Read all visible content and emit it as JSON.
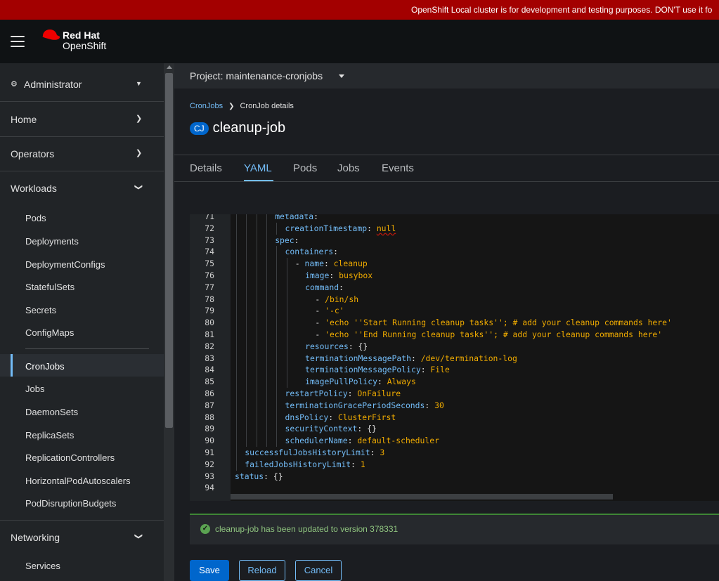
{
  "banner": {
    "text": "OpenShift Local cluster is for development and testing purposes. DON'T use it fo"
  },
  "masthead": {
    "brand_line1": "Red Hat",
    "brand_line2": "OpenShift"
  },
  "sidebar": {
    "perspective": "Administrator",
    "sections": {
      "home": "Home",
      "operators": "Operators",
      "workloads": "Workloads",
      "networking": "Networking"
    },
    "workload_items": [
      "Pods",
      "Deployments",
      "DeploymentConfigs",
      "StatefulSets",
      "Secrets",
      "ConfigMaps",
      "CronJobs",
      "Jobs",
      "DaemonSets",
      "ReplicaSets",
      "ReplicationControllers",
      "HorizontalPodAutoscalers",
      "PodDisruptionBudgets"
    ],
    "networking_items": [
      "Services"
    ],
    "active_item": "CronJobs"
  },
  "project": {
    "label": "Project: maintenance-cronjobs"
  },
  "breadcrumb": {
    "parent": "CronJobs",
    "current": "CronJob details"
  },
  "resource": {
    "badge": "CJ",
    "name": "cleanup-job"
  },
  "tabs": [
    "Details",
    "YAML",
    "Pods",
    "Jobs",
    "Events"
  ],
  "active_tab": "YAML",
  "editor": {
    "lines": [
      {
        "n": "71",
        "indent": 4,
        "key": "metadata",
        "sep": ":",
        "val": ""
      },
      {
        "n": "72",
        "indent": 5,
        "key": "creationTimestamp",
        "sep": ": ",
        "val": "null",
        "squiggle": true
      },
      {
        "n": "73",
        "indent": 4,
        "key": "spec",
        "sep": ":",
        "val": ""
      },
      {
        "n": "74",
        "indent": 5,
        "key": "containers",
        "sep": ":",
        "val": ""
      },
      {
        "n": "75",
        "indent": 6,
        "dash": "- ",
        "key": "name",
        "sep": ": ",
        "val": "cleanup"
      },
      {
        "n": "76",
        "indent": 7,
        "key": "image",
        "sep": ": ",
        "val": "busybox"
      },
      {
        "n": "77",
        "indent": 7,
        "key": "command",
        "sep": ":",
        "val": ""
      },
      {
        "n": "78",
        "indent": 8,
        "dash": "- ",
        "key": "",
        "sep": "",
        "val": "/bin/sh"
      },
      {
        "n": "79",
        "indent": 8,
        "dash": "- ",
        "key": "",
        "sep": "",
        "val": "'-c'"
      },
      {
        "n": "80",
        "indent": 8,
        "dash": "- ",
        "key": "",
        "sep": "",
        "val": "'echo ''Start Running cleanup tasks''; # add your cleanup commands here'"
      },
      {
        "n": "81",
        "indent": 8,
        "dash": "- ",
        "key": "",
        "sep": "",
        "val": "'echo ''End Running cleanup tasks''; # add your cleanup commands here'"
      },
      {
        "n": "82",
        "indent": 7,
        "key": "resources",
        "sep": ": ",
        "val": "{}",
        "plain": true
      },
      {
        "n": "83",
        "indent": 7,
        "key": "terminationMessagePath",
        "sep": ": ",
        "val": "/dev/termination-log"
      },
      {
        "n": "84",
        "indent": 7,
        "key": "terminationMessagePolicy",
        "sep": ": ",
        "val": "File"
      },
      {
        "n": "85",
        "indent": 7,
        "key": "imagePullPolicy",
        "sep": ": ",
        "val": "Always"
      },
      {
        "n": "86",
        "indent": 5,
        "key": "restartPolicy",
        "sep": ": ",
        "val": "OnFailure"
      },
      {
        "n": "87",
        "indent": 5,
        "key": "terminationGracePeriodSeconds",
        "sep": ": ",
        "val": "30"
      },
      {
        "n": "88",
        "indent": 5,
        "key": "dnsPolicy",
        "sep": ": ",
        "val": "ClusterFirst"
      },
      {
        "n": "89",
        "indent": 5,
        "key": "securityContext",
        "sep": ": ",
        "val": "{}",
        "plain": true
      },
      {
        "n": "90",
        "indent": 5,
        "key": "schedulerName",
        "sep": ": ",
        "val": "default-scheduler"
      },
      {
        "n": "91",
        "indent": 1,
        "key": "successfulJobsHistoryLimit",
        "sep": ": ",
        "val": "3"
      },
      {
        "n": "92",
        "indent": 1,
        "key": "failedJobsHistoryLimit",
        "sep": ": ",
        "val": "1"
      },
      {
        "n": "93",
        "indent": 0,
        "key": "status",
        "sep": ": ",
        "val": "{}",
        "plain": true
      },
      {
        "n": "94",
        "indent": 0,
        "key": "",
        "sep": "",
        "val": ""
      }
    ]
  },
  "alert": {
    "message": "cleanup-job has been updated to version 378331"
  },
  "actions": {
    "save": "Save",
    "reload": "Reload",
    "cancel": "Cancel"
  },
  "colors": {
    "accent": "#73bcf7",
    "primary": "#0066cc",
    "banner": "#a30000",
    "success": "#3e8635"
  }
}
